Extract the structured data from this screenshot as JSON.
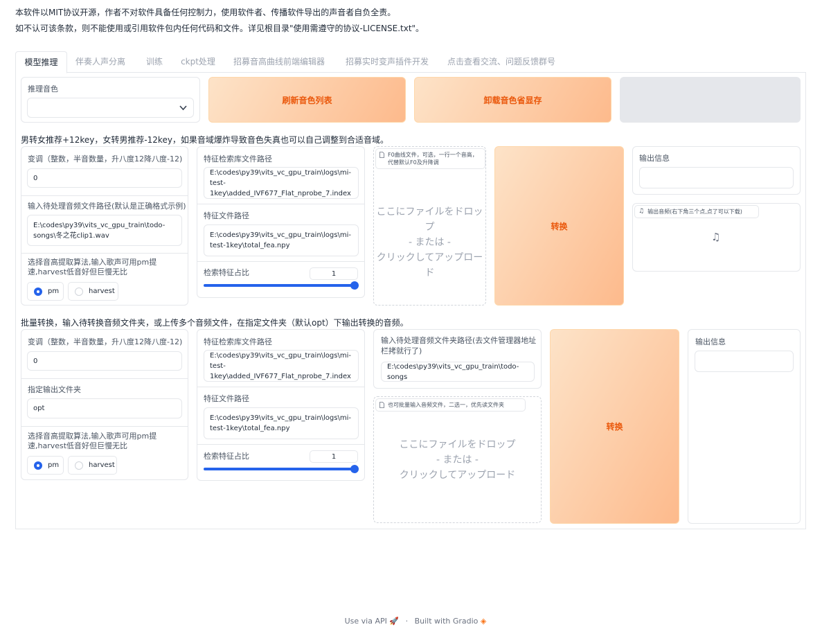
{
  "notice": {
    "line1": "本软件以MIT协议开源，作者不对软件具备任何控制力，使用软件者、传播软件导出的声音者自负全责。",
    "line2": "如不认可该条款，则不能使用或引用软件包内任何代码和文件。详见根目录\"使用需遵守的协议-LICENSE.txt\"。"
  },
  "tabs": [
    "模型推理",
    "伴奏人声分离",
    "训练",
    "ckpt处理",
    "招募音高曲线前端编辑器",
    "招募实时变声插件开发",
    "点击查看交流、问题反馈群号"
  ],
  "top_row": {
    "voice_label": "推理音色",
    "voice_value": "",
    "refresh_button": "刷新音色列表",
    "unload_button": "卸载音色省显存"
  },
  "single": {
    "hint": "男转女推荐+12key，女转男推荐-12key，如果音域爆炸导致音色失真也可以自己调整到合适音域。",
    "transpose_label": "变调（整数，半音数量，升八度12降八度-12)",
    "transpose_value": "0",
    "input_path_label": "输入待处理音频文件路径(默认是正确格式示例)",
    "input_path_value": "E:\\codes\\py39\\vits_vc_gpu_train\\todo-songs\\冬之花clip1.wav",
    "f0_label": "选择音高提取算法,输入歌声可用pm提速,harvest低音好但巨慢无比",
    "f0_options": [
      "pm",
      "harvest"
    ],
    "index_label": "特征检索库文件路径",
    "index_value": "E:\\codes\\py39\\vits_vc_gpu_train\\logs\\mi-test-1key\\added_IVF677_Flat_nprobe_7.index",
    "npy_label": "特征文件路径",
    "npy_value": "E:\\codes\\py39\\vits_vc_gpu_train\\logs\\mi-test-1key\\total_fea.npy",
    "ratio_label": "检索特征占比",
    "ratio_value": "1",
    "ratio_fraction": 1.0,
    "f0_file_label": "F0曲线文件，可选，一行一个音高，代替默认F0及升降调",
    "drop_text": [
      "ここにファイルをドロップ",
      "- または -",
      "クリックしてアップロード"
    ],
    "convert_button": "转换",
    "output_info_label": "输出信息",
    "output_info_value": "",
    "output_audio_label": "输出音频(右下角三个点,点了可以下载)"
  },
  "batch": {
    "hint": "批量转换，输入待转换音频文件夹，或上传多个音频文件，在指定文件夹（默认opt）下输出转换的音频。",
    "transpose_label": "变调（整数，半音数量，升八度12降八度-12)",
    "transpose_value": "0",
    "out_dir_label": "指定输出文件夹",
    "out_dir_value": "opt",
    "f0_label": "选择音高提取算法,输入歌声可用pm提速,harvest低音好但巨慢无比",
    "f0_options": [
      "pm",
      "harvest"
    ],
    "index_label": "特征检索库文件路径",
    "index_value": "E:\\codes\\py39\\vits_vc_gpu_train\\logs\\mi-test-1key\\added_IVF677_Flat_nprobe_7.index",
    "npy_label": "特征文件路径",
    "npy_value": "E:\\codes\\py39\\vits_vc_gpu_train\\logs\\mi-test-1key\\total_fea.npy",
    "ratio_label": "检索特征占比",
    "ratio_value": "1",
    "ratio_fraction": 1.0,
    "dir_label": "输入待处理音频文件夹路径(去文件管理器地址栏拷就行了)",
    "dir_value": "E:\\codes\\py39\\vits_vc_gpu_train\\todo-songs",
    "files_label": "也可批量输入音频文件，二选一，优先读文件夹",
    "drop_text": [
      "ここにファイルをドロップ",
      "- または -",
      "クリックしてアップロード"
    ],
    "convert_button": "转换",
    "output_info_label": "输出信息",
    "output_info_value": ""
  },
  "footer": {
    "api": "Use via API",
    "sep": "·",
    "built": "Built with Gradio"
  }
}
